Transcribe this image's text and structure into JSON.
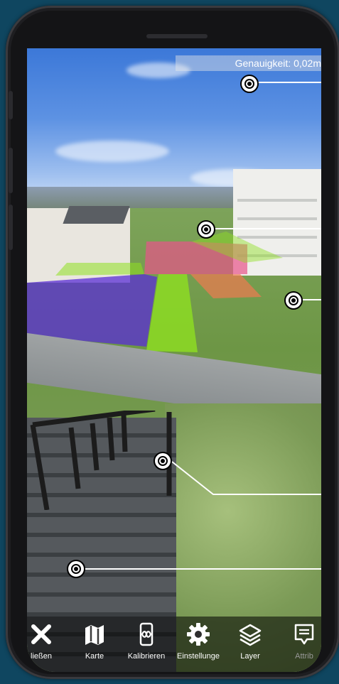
{
  "status": {
    "accuracy": "Genauigkeit: 0,02m"
  },
  "nav": {
    "items": [
      {
        "label": "ließen",
        "icon": "close-icon"
      },
      {
        "label": "Karte",
        "icon": "map-icon"
      },
      {
        "label": "Kalibrieren",
        "icon": "calibrate-phone-icon"
      },
      {
        "label": "Einstellunge",
        "icon": "gear-icon"
      },
      {
        "label": "Layer",
        "icon": "layers-icon"
      },
      {
        "label": "Attrib",
        "icon": "comment-icon"
      }
    ]
  },
  "overlays": {
    "colors": {
      "purple": "#5a2ed6",
      "green": "#8fe021",
      "pink": "#e8548a",
      "orange": "#f07a50"
    }
  }
}
